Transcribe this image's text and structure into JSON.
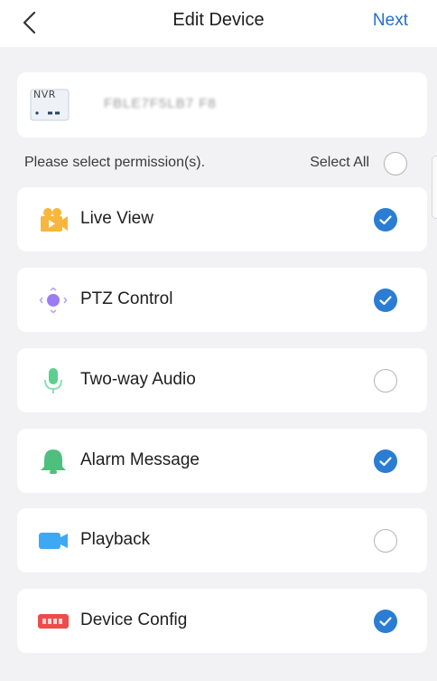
{
  "header": {
    "title": "Edit Device",
    "next_label": "Next"
  },
  "device": {
    "type_label": "NVR",
    "name": "FBLE7F5LB7 F8"
  },
  "prompt": "Please select permission(s).",
  "select_all": {
    "label": "Select All",
    "checked": false
  },
  "permissions": [
    {
      "label": "Live View",
      "icon": "live-view-icon",
      "checked": true
    },
    {
      "label": "PTZ Control",
      "icon": "ptz-control-icon",
      "checked": true
    },
    {
      "label": "Two-way Audio",
      "icon": "microphone-icon",
      "checked": false
    },
    {
      "label": "Alarm Message",
      "icon": "alarm-bell-icon",
      "checked": true
    },
    {
      "label": "Playback",
      "icon": "playback-camera-icon",
      "checked": false
    },
    {
      "label": "Device Config",
      "icon": "device-config-icon",
      "checked": true
    }
  ],
  "colors": {
    "accent": "#2a7dd2",
    "link": "#2070c8",
    "background": "#f2f2f4"
  }
}
